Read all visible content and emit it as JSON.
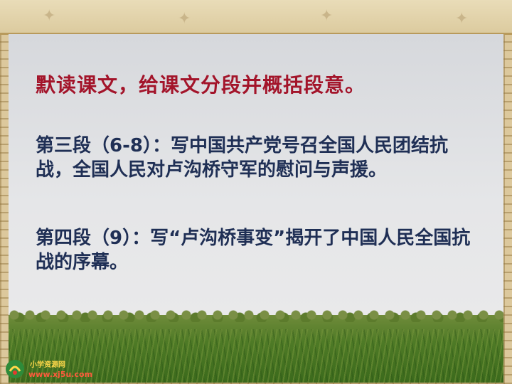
{
  "slide": {
    "title": "默读课文，给课文分段并概括段意。",
    "paragraphs": [
      "第三段（6-8）：写中国共产党号召全国人民团结抗战，全国人民对卢沟桥守军的慰问与声援。",
      "第四段（9）：写“卢沟桥事变”揭开了中国人民全国抗战的序幕。"
    ]
  },
  "logo": {
    "name": "小学资源网",
    "url": "www.xj5u.com"
  },
  "colors": {
    "title": "#a3142a",
    "body_text": "#1f2f55",
    "frame": "#dcc89c"
  }
}
